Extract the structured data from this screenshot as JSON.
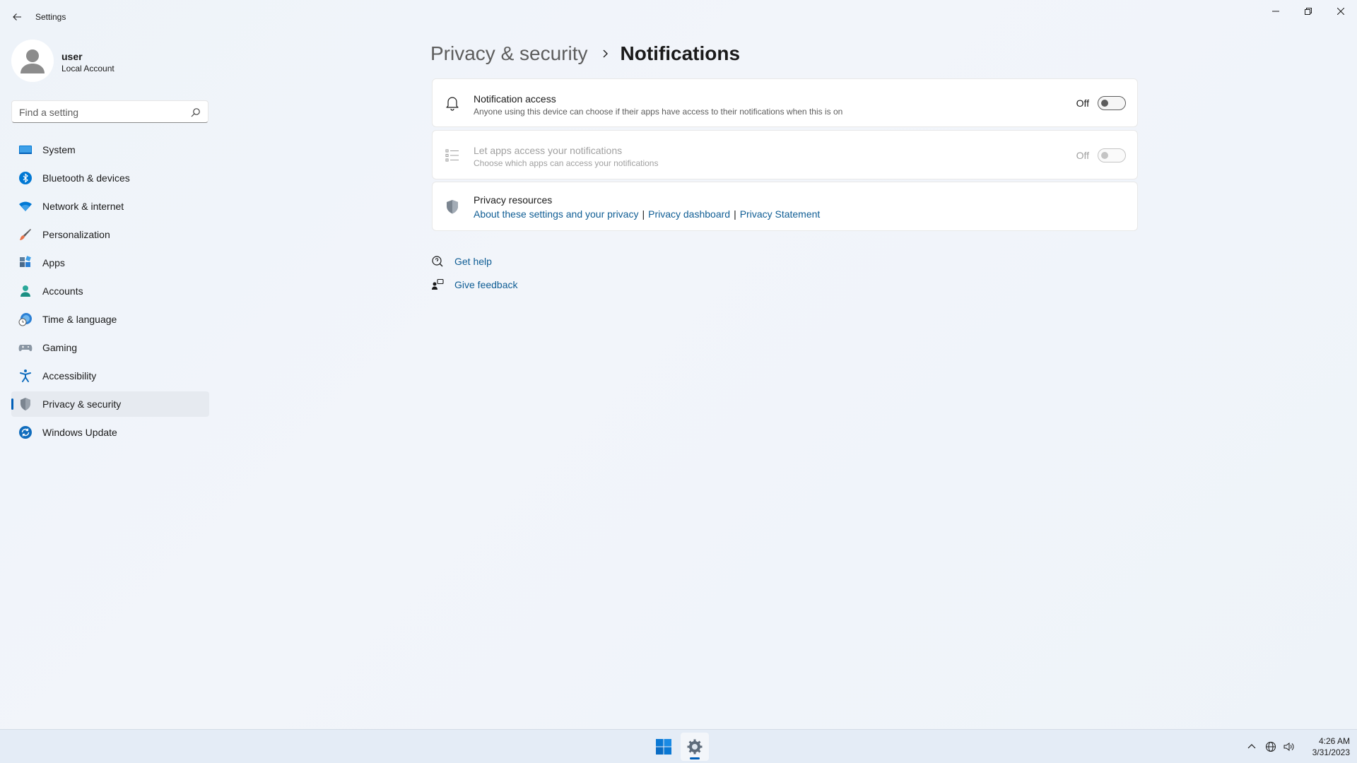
{
  "window": {
    "title": "Settings"
  },
  "user": {
    "name": "user",
    "account_type": "Local Account"
  },
  "search": {
    "placeholder": "Find a setting",
    "value": ""
  },
  "sidebar": {
    "items": [
      {
        "label": "System",
        "icon": "monitor-icon",
        "active": false
      },
      {
        "label": "Bluetooth & devices",
        "icon": "bluetooth-icon",
        "active": false
      },
      {
        "label": "Network & internet",
        "icon": "wifi-icon",
        "active": false
      },
      {
        "label": "Personalization",
        "icon": "brush-icon",
        "active": false
      },
      {
        "label": "Apps",
        "icon": "apps-icon",
        "active": false
      },
      {
        "label": "Accounts",
        "icon": "person-icon",
        "active": false
      },
      {
        "label": "Time & language",
        "icon": "globe-clock-icon",
        "active": false
      },
      {
        "label": "Gaming",
        "icon": "gamepad-icon",
        "active": false
      },
      {
        "label": "Accessibility",
        "icon": "accessibility-icon",
        "active": false
      },
      {
        "label": "Privacy & security",
        "icon": "shield-icon",
        "active": true
      },
      {
        "label": "Windows Update",
        "icon": "update-icon",
        "active": false
      }
    ]
  },
  "breadcrumb": {
    "parent": "Privacy & security",
    "current": "Notifications"
  },
  "cards": {
    "notification_access": {
      "title": "Notification access",
      "description": "Anyone using this device can choose if their apps have access to their notifications when this is on",
      "state": "Off",
      "icon": "bell-icon"
    },
    "apps_access": {
      "title": "Let apps access your notifications",
      "description": "Choose which apps can access your notifications",
      "state": "Off",
      "disabled": true,
      "icon": "list-icon"
    },
    "privacy_resources": {
      "title": "Privacy resources",
      "icon": "shield-icon",
      "links": [
        "About these settings and your privacy",
        "Privacy dashboard",
        "Privacy Statement"
      ],
      "separator": "|"
    }
  },
  "help": {
    "get_help": "Get help",
    "give_feedback": "Give feedback"
  },
  "taskbar": {
    "time": "4:26 AM",
    "date": "3/31/2023"
  },
  "colors": {
    "accent": "#005fb8",
    "link": "#0f5d94",
    "background": "#eef3f9"
  }
}
